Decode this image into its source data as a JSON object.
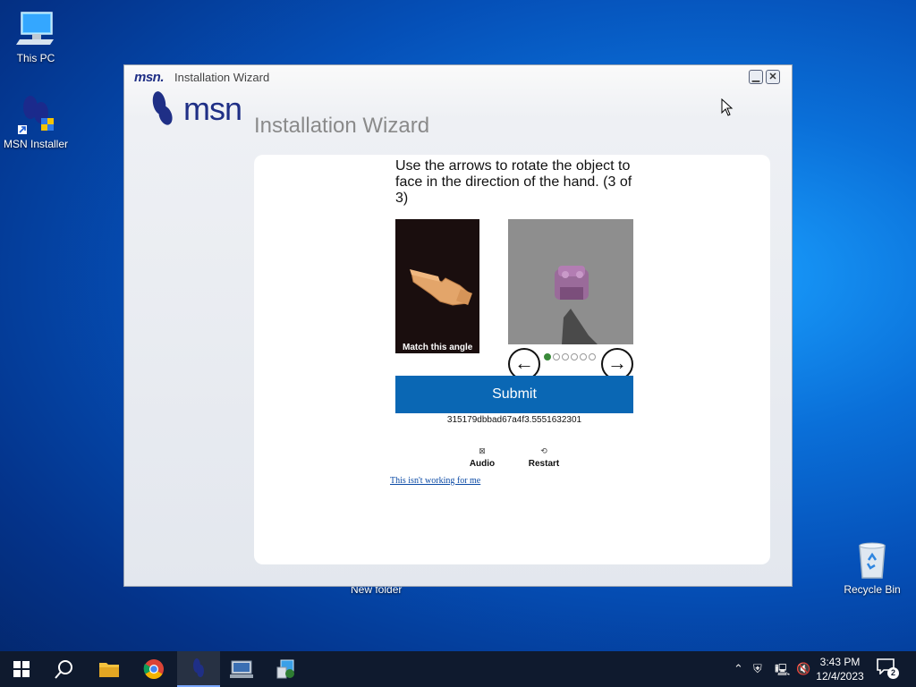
{
  "desktop": {
    "icons": [
      {
        "label": "This PC"
      },
      {
        "label": "MSN Installer"
      },
      {
        "label": "Recycle Bin"
      }
    ],
    "folder_label": "New folder"
  },
  "window": {
    "title_logo": "msn.",
    "title": "Installation Wizard",
    "minimize_glyph": "▁",
    "close_glyph": "✕",
    "brand": "msn",
    "heading": "Installation Wizard",
    "captcha": {
      "instruction": "Use the arrows to rotate the object to face in the direction of the hand. (3 of 3)",
      "reference_label": "Match this angle",
      "left_arrow": "←",
      "right_arrow": "→",
      "dots_total": 6,
      "dots_active_index": 0,
      "submit_label": "Submit",
      "session_id": "315179dbbad67a4f3.5551632301",
      "audio_label": "Audio",
      "restart_label": "Restart",
      "help_link": "This isn't working for me"
    }
  },
  "taskbar": {
    "apps": [
      "start-icon",
      "search-icon",
      "file-explorer-icon",
      "chrome-icon",
      "msn-installer-icon",
      "network-app-icon",
      "setup-app-icon"
    ],
    "active_app": "msn-installer-icon",
    "clock_time": "3:43 PM",
    "clock_date": "12/4/2023",
    "notification_count": "2"
  },
  "colors": {
    "accent": "#0a67b4",
    "msn_blue": "#1f2f86",
    "dot_active": "#3a8a3a"
  }
}
